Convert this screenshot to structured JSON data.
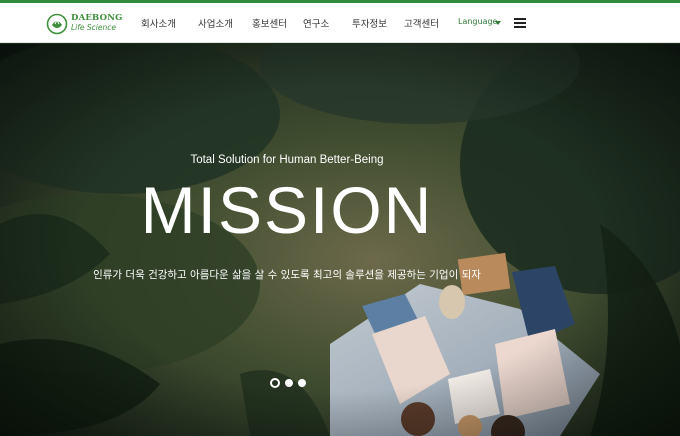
{
  "brand": {
    "logo_line1": "DAEBONG",
    "logo_line2": "Life Science",
    "color": "#3f8f3b"
  },
  "nav": {
    "items": [
      "회사소개",
      "사업소개",
      "홍보센터",
      "연구소",
      "투자정보",
      "고객센터"
    ],
    "language_label": "Language"
  },
  "hero": {
    "tagline": "Total Solution for Human Better-Being",
    "title": "MISSION",
    "description": "인류가 더욱 건강하고 아름다운 삶을 살 수 있도록 최고의 솔루션을 제공하는 기업이 되자",
    "slides_total": 3,
    "slide_active": 1
  },
  "colors": {
    "accent_green": "#2f8a3c",
    "header_bg": "#ffffff"
  },
  "icons": {
    "menu": "hamburger-menu-icon",
    "language_caret": "caret-down-icon",
    "logo_mark": "leaf-circle-logo-icon"
  }
}
